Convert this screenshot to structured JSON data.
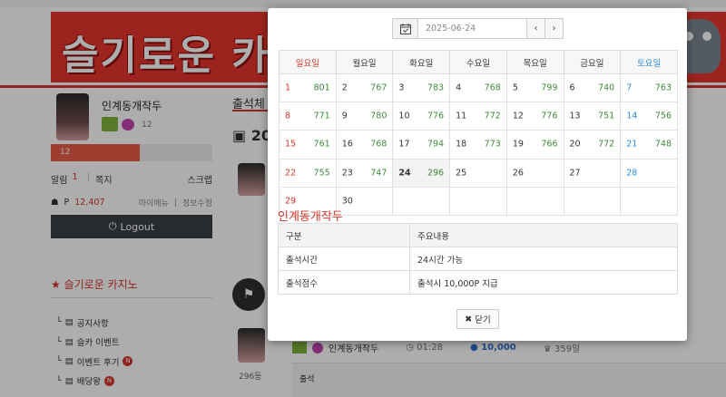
{
  "bg": {
    "banner_text": "슬기로운 카",
    "profile": {
      "name": "인계동개작두",
      "badge_num": "12",
      "level": "12",
      "level_progress": 0.55
    },
    "memo": {
      "alarm_label": "알림",
      "alarm_count": "1",
      "note_label": "쪽지",
      "scrap_label": "스크랩"
    },
    "points": {
      "icon": "coins-icon",
      "prefix": "P",
      "value": "12,407",
      "menu_label": "마이메뉴",
      "edit_label": "정보수정"
    },
    "logout_label": "Logout",
    "side_title": "슬기로운 카지노",
    "side_menu": [
      {
        "label": "공지사항",
        "new": ""
      },
      {
        "label": "슬카 이벤트",
        "new": ""
      },
      {
        "label": "이벤트 후기",
        "new": "N"
      },
      {
        "label": "배당왕",
        "new": "N"
      }
    ],
    "mid_title": "출석체",
    "mid_year": "20",
    "mid_rank": "296등",
    "bottom": {
      "name": "인계동개작두",
      "time": "01:28",
      "points": "10,000",
      "rank": "359일",
      "content": "출석"
    }
  },
  "modal": {
    "date_value": "2025-06-24",
    "weekdays": [
      "일요일",
      "월요일",
      "화요일",
      "수요일",
      "목요일",
      "금요일",
      "토요일"
    ],
    "weeks": [
      [
        {
          "d": "1",
          "c": "801"
        },
        {
          "d": "2",
          "c": "767"
        },
        {
          "d": "3",
          "c": "783"
        },
        {
          "d": "4",
          "c": "768"
        },
        {
          "d": "5",
          "c": "799"
        },
        {
          "d": "6",
          "c": "740"
        },
        {
          "d": "7",
          "c": "763"
        }
      ],
      [
        {
          "d": "8",
          "c": "771"
        },
        {
          "d": "9",
          "c": "780"
        },
        {
          "d": "10",
          "c": "776"
        },
        {
          "d": "11",
          "c": "772"
        },
        {
          "d": "12",
          "c": "776"
        },
        {
          "d": "13",
          "c": "751"
        },
        {
          "d": "14",
          "c": "756"
        }
      ],
      [
        {
          "d": "15",
          "c": "761"
        },
        {
          "d": "16",
          "c": "768"
        },
        {
          "d": "17",
          "c": "794"
        },
        {
          "d": "18",
          "c": "773"
        },
        {
          "d": "19",
          "c": "766"
        },
        {
          "d": "20",
          "c": "772"
        },
        {
          "d": "21",
          "c": "748"
        }
      ],
      [
        {
          "d": "22",
          "c": "755"
        },
        {
          "d": "23",
          "c": "747"
        },
        {
          "d": "24",
          "c": "296"
        },
        {
          "d": "25",
          "c": ""
        },
        {
          "d": "26",
          "c": ""
        },
        {
          "d": "27",
          "c": ""
        },
        {
          "d": "28",
          "c": ""
        }
      ],
      [
        {
          "d": "29",
          "c": ""
        },
        {
          "d": "30",
          "c": ""
        },
        {
          "d": "",
          "c": ""
        },
        {
          "d": "",
          "c": ""
        },
        {
          "d": "",
          "c": ""
        },
        {
          "d": "",
          "c": ""
        },
        {
          "d": "",
          "c": ""
        }
      ]
    ],
    "today": "24",
    "user_title": "인계동개작두",
    "info_headers": [
      "구분",
      "주요내용"
    ],
    "info_rows": [
      [
        "출석시간",
        "24시간 가능"
      ],
      [
        "출석점수",
        "출석시 10,000P 지급"
      ]
    ],
    "close_label": "닫기",
    "colors": {
      "sunday": "#d8362b",
      "saturday": "#2f8ed6",
      "count": "#3f8a3a",
      "accent": "#d8362b"
    }
  }
}
